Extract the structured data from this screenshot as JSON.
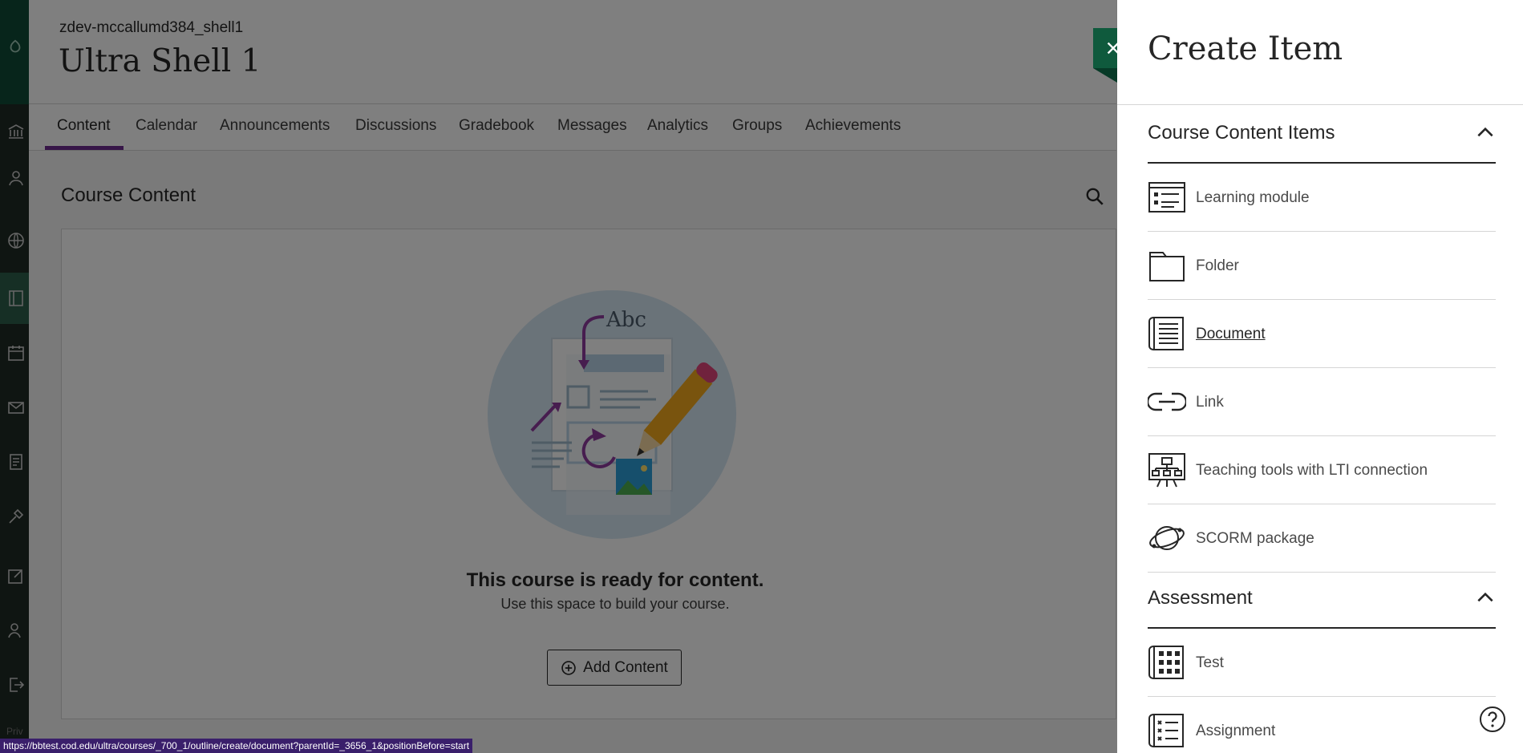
{
  "course": {
    "code": "zdev-mccallumd384_shell1",
    "title": "Ultra Shell 1",
    "tabs": [
      "Content",
      "Calendar",
      "Announcements",
      "Discussions",
      "Gradebook",
      "Messages",
      "Analytics",
      "Groups",
      "Achievements"
    ],
    "active_tab": "Content",
    "content_heading": "Course Content",
    "empty_title": "This course is ready for content.",
    "empty_subtitle": "Use this space to build your course.",
    "add_button": "Add Content",
    "illustration_text": "Abc"
  },
  "rail": {
    "footer_text": "Priv"
  },
  "panel": {
    "title": "Create Item",
    "sections": [
      {
        "label": "Course Content Items",
        "items": [
          {
            "label": "Learning module",
            "icon": "learning-module-icon"
          },
          {
            "label": "Folder",
            "icon": "folder-icon"
          },
          {
            "label": "Document",
            "icon": "document-icon"
          },
          {
            "label": "Link",
            "icon": "link-icon"
          },
          {
            "label": "Teaching tools with LTI connection",
            "icon": "lti-tools-icon"
          },
          {
            "label": "SCORM package",
            "icon": "scorm-icon"
          }
        ]
      },
      {
        "label": "Assessment",
        "items": [
          {
            "label": "Test",
            "icon": "test-icon"
          },
          {
            "label": "Assignment",
            "icon": "assignment-icon"
          }
        ]
      }
    ]
  },
  "status_bar": {
    "url": "https://bbtest.cod.edu/ultra/courses/_700_1/outline/create/document?parentId=_3656_1&positionBefore=start"
  },
  "colors": {
    "brand_green": "#0f5a3d",
    "accent_purple": "#6f2c91",
    "overlay": "rgba(0,0,0,0.5)"
  }
}
